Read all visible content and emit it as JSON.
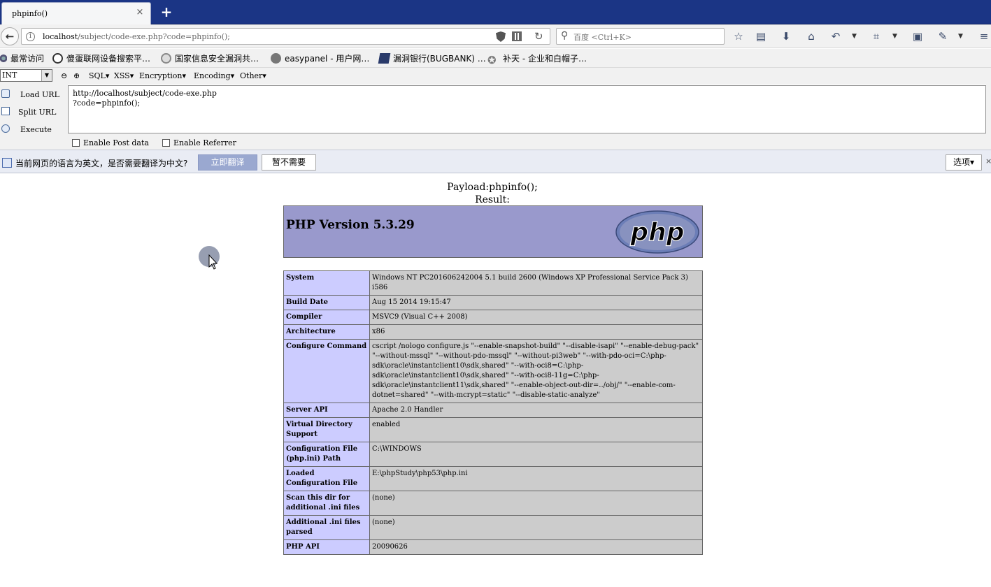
{
  "tab": {
    "title": "phpinfo()",
    "close": "×",
    "new_tab": "+"
  },
  "navbar": {
    "back": "←",
    "url_host": "localhost",
    "url_path": "/subject/code-exe.php?code=phpinfo();",
    "reload": "↻",
    "search_placeholder": "百度 <Ctrl+K>"
  },
  "bookmarks": [
    {
      "label": "最常访问",
      "icon": "gear-icon"
    },
    {
      "label": "傻蛋联网设备搜索平…",
      "icon": "globe-icon"
    },
    {
      "label": "国家信息安全漏洞共…",
      "icon": "shield-icon"
    },
    {
      "label": "easypanel - 用户网…",
      "icon": "globe-icon"
    },
    {
      "label": "漏洞银行(BUGBANK) …",
      "icon": "bank-icon"
    },
    {
      "label": "补天 - 企业和白帽子…",
      "icon": "star-icon"
    }
  ],
  "hackbar": {
    "select": "INT",
    "menus": [
      "SQL",
      "XSS",
      "Encryption",
      "Encoding",
      "Other"
    ],
    "buttons": [
      "Load URL",
      "Split URL",
      "Execute"
    ],
    "url_text": "http://localhost/subject/code-exe.php\n?code=phpinfo();",
    "enable_post": "Enable Post data",
    "enable_referrer": "Enable Referrer"
  },
  "translate": {
    "message": "当前网页的语言为英文，是否需要翻译为中文?",
    "translate_now": "立即翻译",
    "not_needed": "暂不需要",
    "options": "选项▾",
    "close": "×"
  },
  "page": {
    "payload": "Payload:phpinfo();",
    "result": "Result:",
    "php_version": "PHP Version 5.3.29",
    "logo_text": "php",
    "rows": [
      [
        "System",
        "Windows NT PC201606242004 5.1 build 2600 (Windows XP Professional Service Pack 3) i586"
      ],
      [
        "Build Date",
        "Aug 15 2014 19:15:47"
      ],
      [
        "Compiler",
        "MSVC9 (Visual C++ 2008)"
      ],
      [
        "Architecture",
        "x86"
      ],
      [
        "Configure Command",
        "cscript /nologo configure.js \"--enable-snapshot-build\" \"--disable-isapi\" \"--enable-debug-pack\" \"--without-mssql\" \"--without-pdo-mssql\" \"--without-pi3web\" \"--with-pdo-oci=C:\\php-sdk\\oracle\\instantclient10\\sdk,shared\" \"--with-oci8=C:\\php-sdk\\oracle\\instantclient10\\sdk,shared\" \"--with-oci8-11g=C:\\php-sdk\\oracle\\instantclient11\\sdk,shared\" \"--enable-object-out-dir=../obj/\" \"--enable-com-dotnet=shared\" \"--with-mcrypt=static\" \"--disable-static-analyze\""
      ],
      [
        "Server API",
        "Apache 2.0 Handler"
      ],
      [
        "Virtual Directory Support",
        "enabled"
      ],
      [
        "Configuration File (php.ini) Path",
        "C:\\WINDOWS"
      ],
      [
        "Loaded Configuration File",
        "E:\\phpStudy\\php53\\php.ini"
      ],
      [
        "Scan this dir for additional .ini files",
        "(none)"
      ],
      [
        "Additional .ini files parsed",
        "(none)"
      ],
      [
        "PHP API",
        "20090626"
      ]
    ]
  },
  "colors": {
    "tabbar": "#1b3585",
    "php_banner": "#9999cc",
    "php_key": "#ccccff",
    "php_value": "#cccccc"
  }
}
